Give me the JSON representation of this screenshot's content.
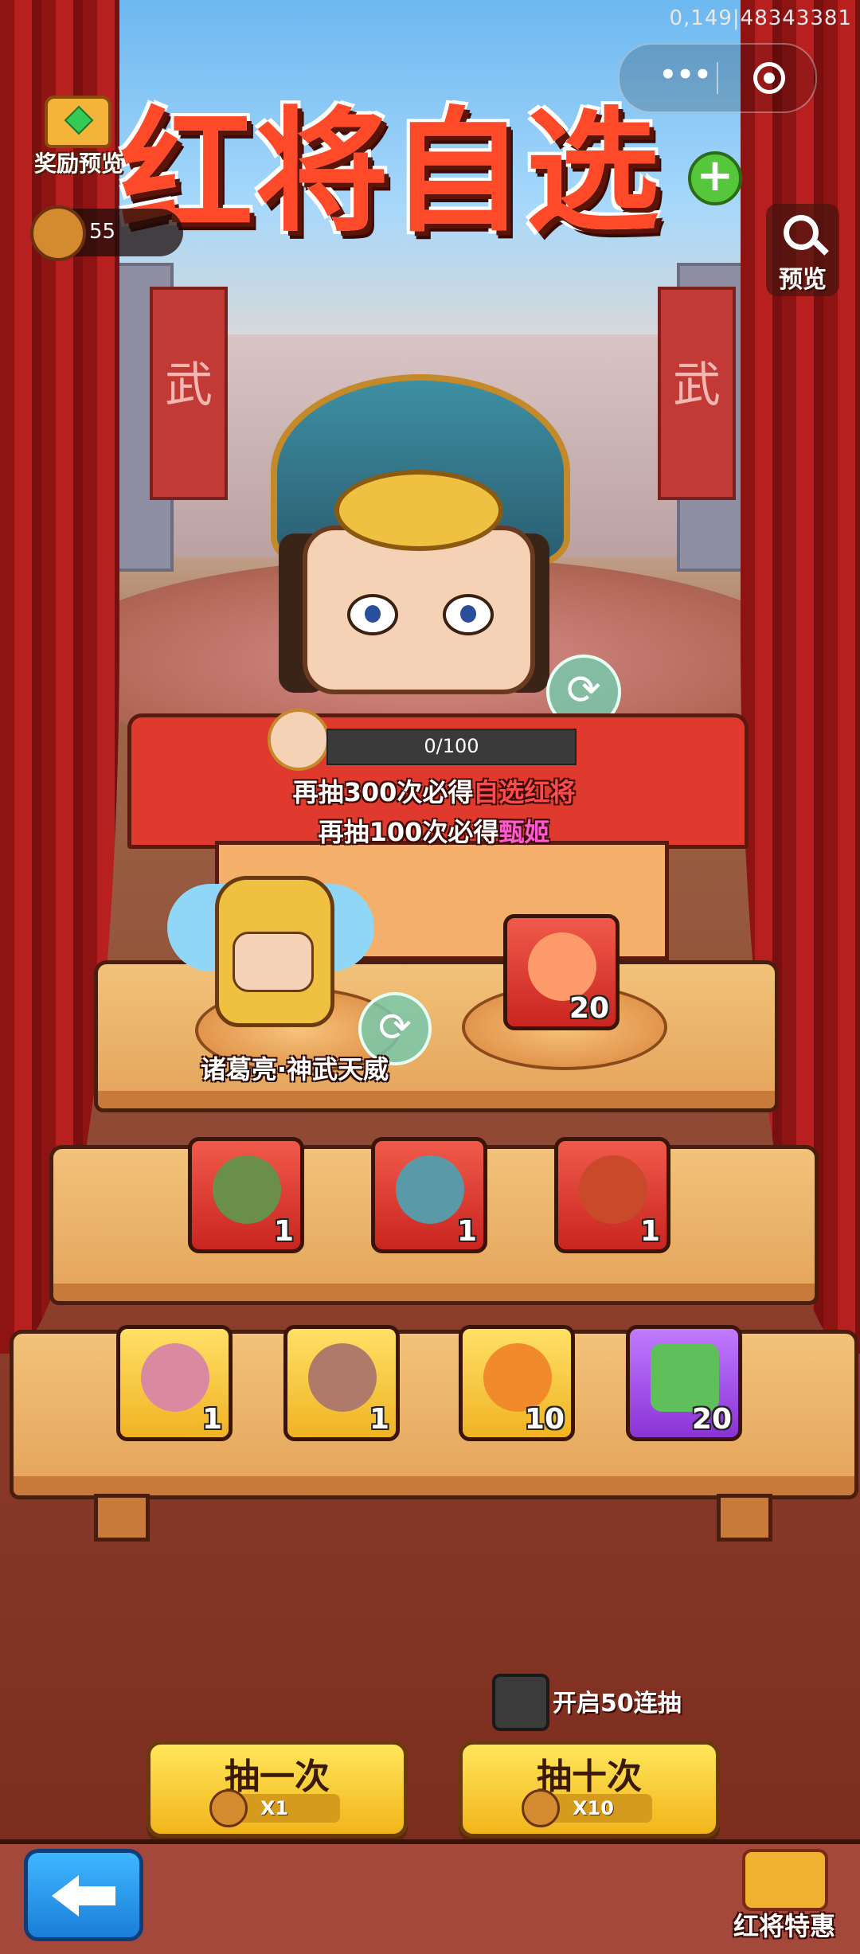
{
  "status": {
    "top_id": "0,149|48343381"
  },
  "header": {
    "title": "红将自选",
    "title_plus": "+",
    "reward_preview_label": "奖励预览",
    "currency_value": "55",
    "preview_label": "预览"
  },
  "banner_glyph": "武",
  "progress": {
    "text": "0/100",
    "current": 0,
    "max": 100
  },
  "hints": {
    "line1_prefix": "再抽300次必得",
    "line1_highlight": "自选红将",
    "line2_prefix": "再抽100次必得",
    "line2_highlight": "甄姬"
  },
  "featured": {
    "name": "诸葛亮·神武天威",
    "side_item_qty": "20"
  },
  "row2": [
    {
      "qty": "1"
    },
    {
      "qty": "1"
    },
    {
      "qty": "1"
    }
  ],
  "row3": [
    {
      "qty": "1"
    },
    {
      "qty": "1"
    },
    {
      "qty": "10"
    },
    {
      "qty": "20"
    }
  ],
  "controls": {
    "auto50_label": "开启50连抽",
    "draw_one_label": "抽一次",
    "draw_one_cost": "X1",
    "draw_ten_label": "抽十次",
    "draw_ten_cost": "X10",
    "promo_label": "红将特惠"
  },
  "icons": {
    "swap": "⟳"
  },
  "colors": {
    "accent_red": "#ff4b4b",
    "accent_pink": "#ff5bd0",
    "button_yellow": "#f2b51b"
  }
}
